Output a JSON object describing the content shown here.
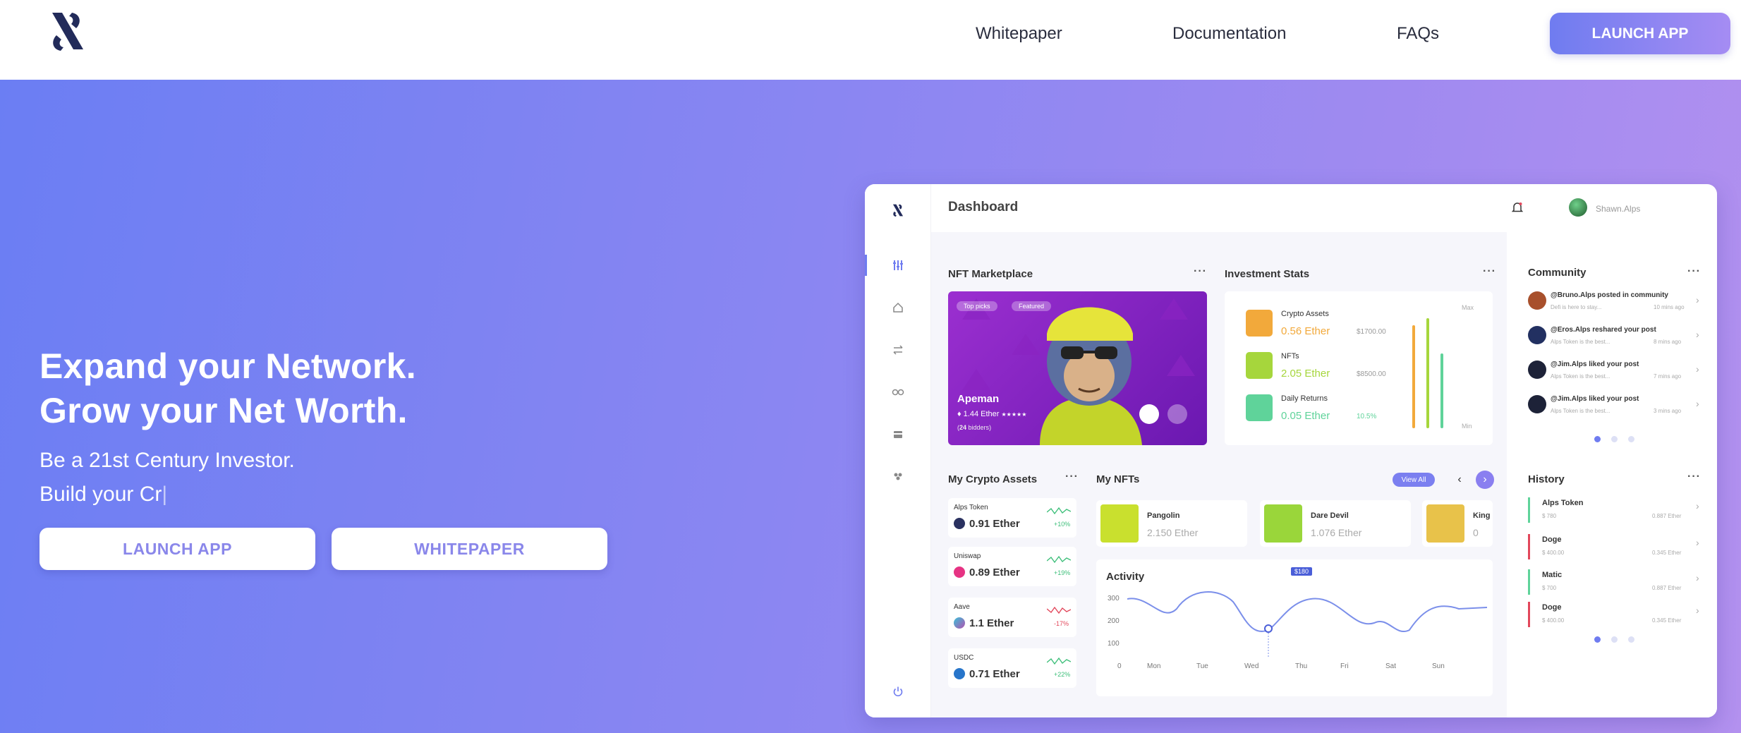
{
  "nav": {
    "whitepaper": "Whitepaper",
    "documentation": "Documentation",
    "faqs": "FAQs",
    "launch_app": "LAUNCH APP"
  },
  "hero": {
    "headline_1": "Expand your Network.",
    "headline_2": "Grow your Net Worth.",
    "sub_1": "Be a 21st Century Investor.",
    "sub_2_prefix": "Build your ",
    "sub_2_typed": "Cr",
    "button_launch": "LAUNCH APP",
    "button_whitepaper": "WHITEPAPER"
  },
  "dashboard": {
    "title": "Dashboard",
    "user_name": "Shawn.Alps",
    "nft_marketplace": {
      "title": "NFT Marketplace",
      "tags": [
        "Top picks",
        "Featured"
      ],
      "name": "Apeman",
      "price": "1.44 Ether",
      "stars": "★★★★★",
      "bidders_count": "24",
      "bidders_label": "bidders"
    },
    "investment_stats": {
      "title": "Investment Stats",
      "items": [
        {
          "label": "Crypto Assets",
          "value": "0.56 Ether",
          "usd": "$1700.00",
          "color": "#f2a93b"
        },
        {
          "label": "NFTs",
          "value": "2.05 Ether",
          "usd": "$8500.00",
          "color": "#a6d63c"
        },
        {
          "label": "Daily Returns",
          "value": "0.05 Ether",
          "usd": "10.5%",
          "color": "#5fd39a"
        }
      ],
      "max_label": "Max",
      "min_label": "Min"
    },
    "crypto_assets": {
      "title": "My Crypto Assets",
      "items": [
        {
          "name": "Alps Token",
          "value": "0.91 Ether",
          "change": "+10%",
          "color": "#3ebf7a"
        },
        {
          "name": "Uniswap",
          "value": "0.89 Ether",
          "change": "+19%",
          "color": "#3ebf7a"
        },
        {
          "name": "Aave",
          "value": "1.1 Ether",
          "change": "-17%",
          "color": "#e2475b"
        },
        {
          "name": "USDC",
          "value": "0.71 Ether",
          "change": "+22%",
          "color": "#3ebf7a"
        }
      ]
    },
    "my_nfts": {
      "title": "My NFTs",
      "view_all": "View All",
      "items": [
        {
          "name": "Pangolin",
          "price": "2.150 Ether"
        },
        {
          "name": "Dare Devil",
          "price": "1.076 Ether"
        },
        {
          "name": "King",
          "price": "0"
        }
      ]
    },
    "activity": {
      "title": "Activity",
      "tooltip": "$180",
      "y_ticks": [
        "300",
        "200",
        "100",
        "0"
      ],
      "days": [
        "Mon",
        "Tue",
        "Wed",
        "Thu",
        "Fri",
        "Sat",
        "Sun"
      ]
    },
    "community": {
      "title": "Community",
      "items": [
        {
          "title": "@Bruno.Alps posted in community",
          "sub": "Defi is here to stay...",
          "time": "10 mins ago"
        },
        {
          "title": "@Eros.Alps reshared your post",
          "sub": "Alps Token is the best...",
          "time": "8 mins ago"
        },
        {
          "title": "@Jim.Alps liked your post",
          "sub": "Alps Token is the best...",
          "time": "7 mins ago"
        },
        {
          "title": "@Jim.Alps liked your post",
          "sub": "Alps Token is the best...",
          "time": "3 mins ago"
        }
      ]
    },
    "history": {
      "title": "History",
      "items": [
        {
          "name": "Alps Token",
          "usd": "$ 780",
          "eth": "0.887 Ether",
          "color": "#5fd39a"
        },
        {
          "name": "Doge",
          "usd": "$ 400.00",
          "eth": "0.345 Ether",
          "color": "#e2475b"
        },
        {
          "name": "Matic",
          "usd": "$ 700",
          "eth": "0.887 Ether",
          "color": "#5fd39a"
        },
        {
          "name": "Doge",
          "usd": "$ 400.00",
          "eth": "0.345 Ether",
          "color": "#e2475b"
        }
      ]
    }
  },
  "colors": {
    "accent": "#7b7ff0",
    "hero_gradient_start": "#6b7ef3",
    "hero_gradient_end": "#b391ef",
    "button_text": "#8a87ea"
  }
}
